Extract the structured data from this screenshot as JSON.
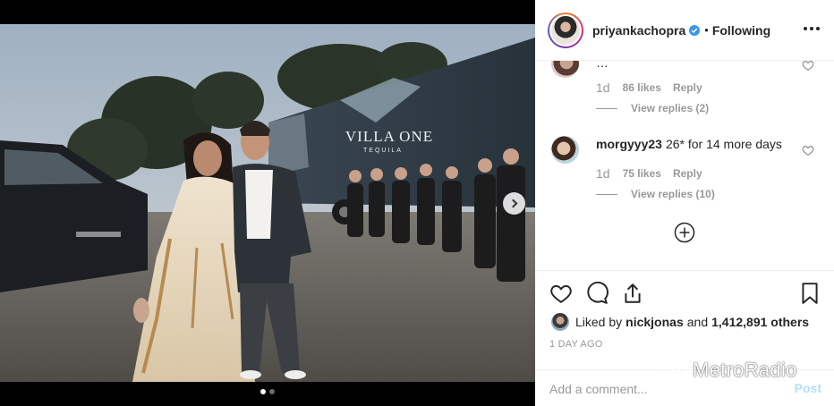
{
  "post": {
    "username": "priyankachopra",
    "verified": true,
    "separator": "•",
    "follow_status": "Following",
    "more_icon": "more-horizontal-icon"
  },
  "media": {
    "truck_brand": "VILLA ONE",
    "truck_subtitle": "TEQUILA",
    "slide_index": 1,
    "slide_count": 2
  },
  "comments": [
    {
      "username": "",
      "text": "…",
      "time": "1d",
      "likes": "86 likes",
      "reply_label": "Reply",
      "view_replies": "View replies (2)"
    },
    {
      "username": "morgyyy23",
      "text": "26* for 14 more days",
      "time": "1d",
      "likes": "75 likes",
      "reply_label": "Reply",
      "view_replies": "View replies (10)"
    }
  ],
  "engagement": {
    "liked_by_prefix": "Liked by",
    "liked_by_user": "nickjonas",
    "liked_by_and": "and",
    "liked_by_count": "1,412,891 others",
    "time_ago": "1 DAY AGO"
  },
  "composer": {
    "placeholder": "Add a comment...",
    "post_label": "Post"
  },
  "watermark": "MetroRadio",
  "colors": {
    "verified": "#3897f0",
    "post_disabled": "#b2dffc",
    "muted": "#999999",
    "text": "#262626"
  }
}
